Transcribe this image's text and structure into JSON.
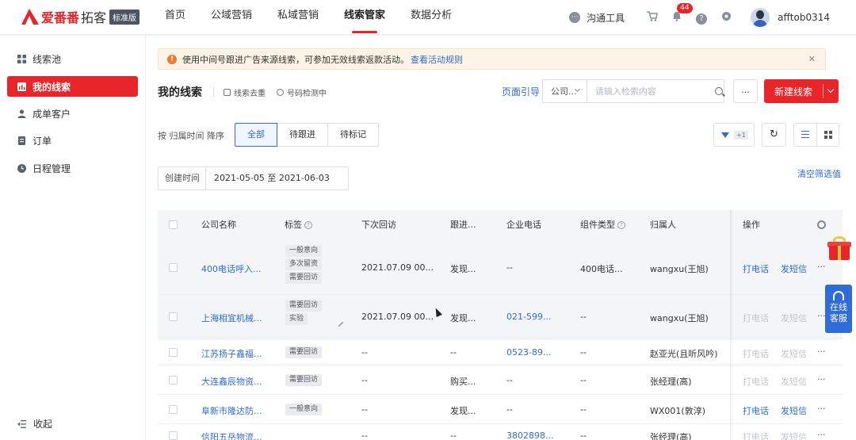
{
  "header": {
    "logo_text": "爱番番",
    "logo_sub": "拓客",
    "logo_badge": "标准版",
    "nav": [
      "首页",
      "公域营销",
      "私域营销",
      "线索管家",
      "数据分析"
    ],
    "nav_active": 3,
    "chat_tool": "沟通工具",
    "bell_count": "44",
    "username": "afftob0314"
  },
  "sidebar": {
    "items": [
      "线索池",
      "我的线索",
      "成单客户",
      "订单",
      "日程管理"
    ],
    "active": 1,
    "collapse": "收起"
  },
  "notice": {
    "text": "使用中间号跟进广告来源线索，可参加无效线索返款活动。",
    "link": "查看活动规则"
  },
  "toolbar": {
    "title": "我的线索",
    "dedupe": "线索去重",
    "phone_check": "号码检测中",
    "page_guide": "页面引导",
    "search_select": "公司...",
    "search_placeholder": "请输入检索内容",
    "more": "...",
    "new_lead": "新建线索"
  },
  "filters": {
    "sort_label": "按 归属时间 降序",
    "tabs": [
      "全部",
      "待跟进",
      "待标记"
    ],
    "tab_active": 0,
    "filter_count": "+1",
    "date_label": "创建时间",
    "date_value": "2021-05-05  至  2021-06-03",
    "clear": "清空筛选值"
  },
  "table": {
    "columns": [
      "公司名称",
      "标签",
      "下次回访",
      "跟进...",
      "企业电话",
      "组件类型",
      "归属人",
      "操作"
    ],
    "call": "打电话",
    "sms": "发短信",
    "more": "···",
    "rows": [
      {
        "company": "400电话呼入...",
        "tags": [
          "一般意向",
          "多次留资",
          "需要回访"
        ],
        "visit": "2021.07.09 00...",
        "follow": "发现...",
        "phone": "--",
        "widget": "400电话...",
        "owner": "wangxu(王旭)",
        "actions_enabled": true
      },
      {
        "company": "上海相宜机械...",
        "tags": [
          "需要回访",
          "实验"
        ],
        "visit": "2021.07.09 00...",
        "follow": "发现...",
        "phone": "021-599...",
        "widget": "--",
        "owner": "wangxu(王旭)",
        "actions_enabled": false
      },
      {
        "company": "江苏扬子鑫福...",
        "tags": [
          "需要回访"
        ],
        "visit": "--",
        "follow": "--",
        "phone": "0523-89...",
        "widget": "--",
        "owner": "赵亚光(且听风吟)",
        "actions_enabled": false
      },
      {
        "company": "大连鑫辰物资...",
        "tags": [
          "需要回访"
        ],
        "visit": "--",
        "follow": "购买...",
        "phone": "--",
        "widget": "--",
        "owner": "张经理(高)",
        "actions_enabled": false
      },
      {
        "company": "阜新市隆达防...",
        "tags": [
          "一般意向"
        ],
        "visit": "--",
        "follow": "发现...",
        "phone": "--",
        "widget": "--",
        "owner": "WX001(敦淳)",
        "actions_enabled": true
      },
      {
        "company": "信阳五岳物流...",
        "tags": [],
        "visit": "--",
        "follow": "--",
        "phone": "3802898...",
        "widget": "--",
        "owner": "张经理(高)",
        "actions_enabled": false
      }
    ]
  },
  "floating": {
    "service": "在线客服"
  }
}
